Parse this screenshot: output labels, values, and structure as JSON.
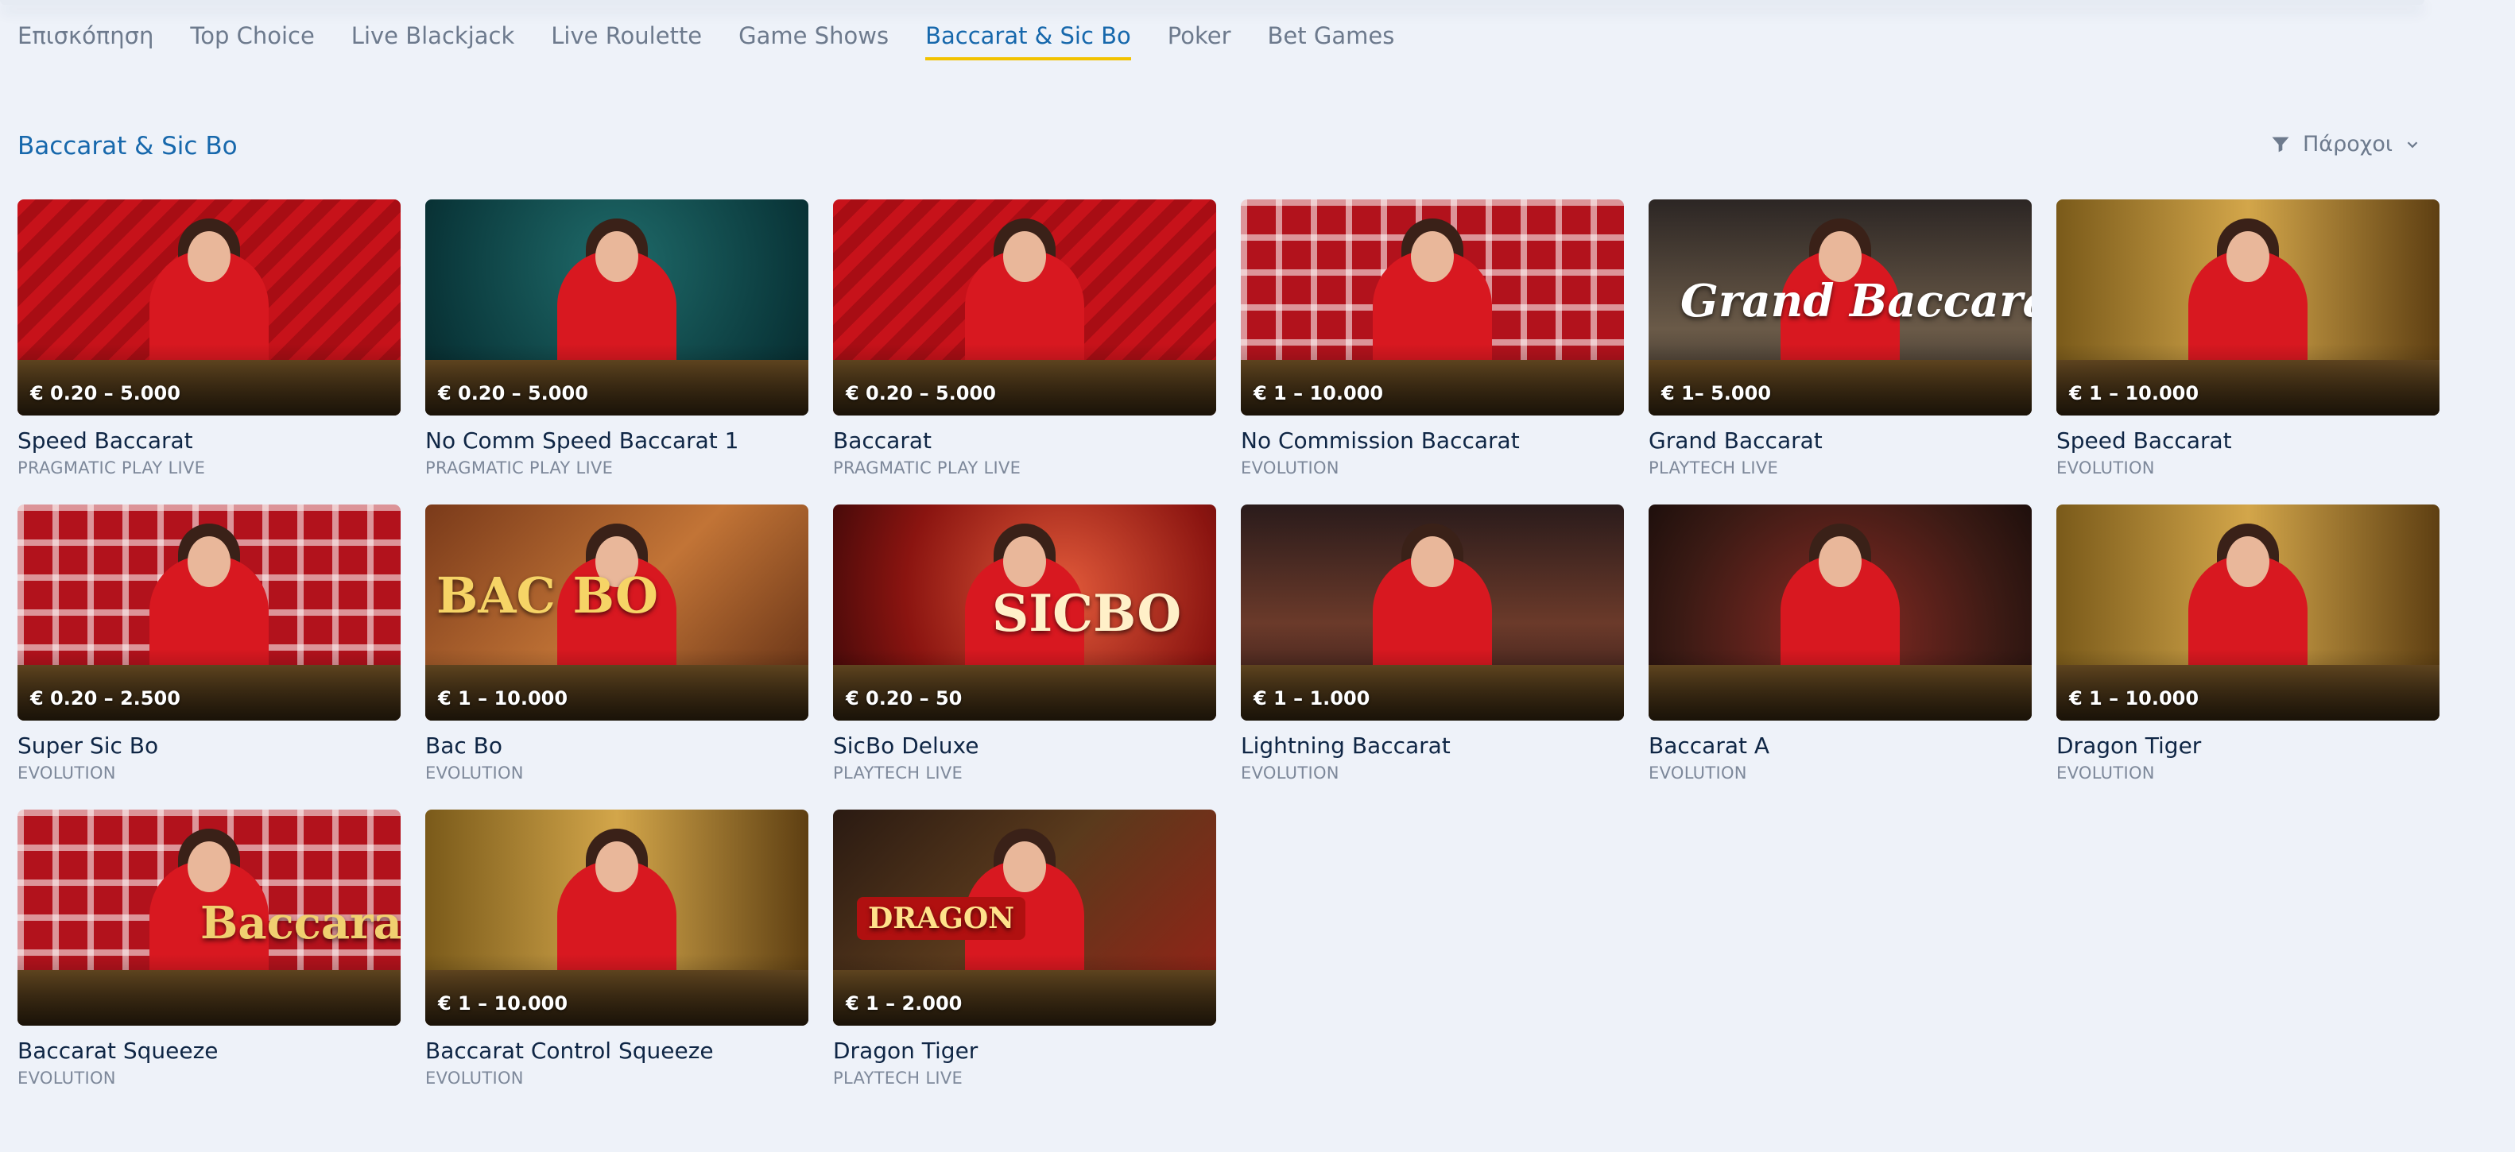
{
  "tabs": [
    {
      "label": "Επισκόπηση",
      "active": false
    },
    {
      "label": "Top Choice",
      "active": false
    },
    {
      "label": "Live Blackjack",
      "active": false
    },
    {
      "label": "Live Roulette",
      "active": false
    },
    {
      "label": "Game Shows",
      "active": false
    },
    {
      "label": "Baccarat & Sic Bo",
      "active": true
    },
    {
      "label": "Poker",
      "active": false
    },
    {
      "label": "Bet Games",
      "active": false
    }
  ],
  "section": {
    "title": "Baccarat & Sic Bo",
    "filter_label": "Πάροχοι",
    "filter_icon": "funnel-icon",
    "chevron_icon": "chevron-down-icon"
  },
  "colors": {
    "accent": "#1768ac",
    "active_underline": "#f2c200",
    "background": "#eef2f9"
  },
  "games": [
    {
      "name": "Speed Baccarat",
      "provider": "PRAGMATIC PLAY LIVE",
      "limit": "€ 0.20 – 5.000",
      "theme": "bg-red"
    },
    {
      "name": "No Comm Speed Baccarat 1",
      "provider": "PRAGMATIC PLAY LIVE",
      "limit": "€ 0.20 – 5.000",
      "theme": "bg-teal"
    },
    {
      "name": "Baccarat",
      "provider": "PRAGMATIC PLAY LIVE",
      "limit": "€ 0.20 – 5.000",
      "theme": "bg-red"
    },
    {
      "name": "No Commission Baccarat",
      "provider": "EVOLUTION",
      "limit": "€ 1 – 10.000",
      "theme": "bg-lattice"
    },
    {
      "name": "Grand Baccarat",
      "provider": "PLAYTECH LIVE",
      "limit": "€ 1– 5.000",
      "theme": "bg-dark",
      "logo": "Grand Baccarat"
    },
    {
      "name": "Speed Baccarat",
      "provider": "EVOLUTION",
      "limit": "€ 1 – 10.000",
      "theme": "bg-gold"
    },
    {
      "name": "Super Sic Bo",
      "provider": "EVOLUTION",
      "limit": "€ 0.20 – 2.500",
      "theme": "bg-lattice"
    },
    {
      "name": "Bac Bo",
      "provider": "EVOLUTION",
      "limit": "€ 1 – 10.000",
      "theme": "bg-brown",
      "logo": "BAC BO"
    },
    {
      "name": "SicBo Deluxe",
      "provider": "PLAYTECH LIVE",
      "limit": "€ 0.20 – 50",
      "theme": "bg-sicbo",
      "logo": "SICBO"
    },
    {
      "name": "Lightning Baccarat",
      "provider": "EVOLUTION",
      "limit": "€ 1 – 1.000",
      "theme": "bg-hall"
    },
    {
      "name": "Baccarat A",
      "provider": "EVOLUTION",
      "limit": "",
      "theme": "bg-casino"
    },
    {
      "name": "Dragon Tiger",
      "provider": "EVOLUTION",
      "limit": "€ 1 – 10.000",
      "theme": "bg-gold"
    },
    {
      "name": "Baccarat Squeeze",
      "provider": "EVOLUTION",
      "limit": "",
      "theme": "bg-lattice",
      "logo": "Baccarat"
    },
    {
      "name": "Baccarat Control Squeeze",
      "provider": "EVOLUTION",
      "limit": "€ 1 – 10.000",
      "theme": "bg-gold"
    },
    {
      "name": "Dragon Tiger",
      "provider": "PLAYTECH LIVE",
      "limit": "€ 1 – 2.000",
      "theme": "bg-dragon",
      "logo": "DRAGON"
    }
  ]
}
